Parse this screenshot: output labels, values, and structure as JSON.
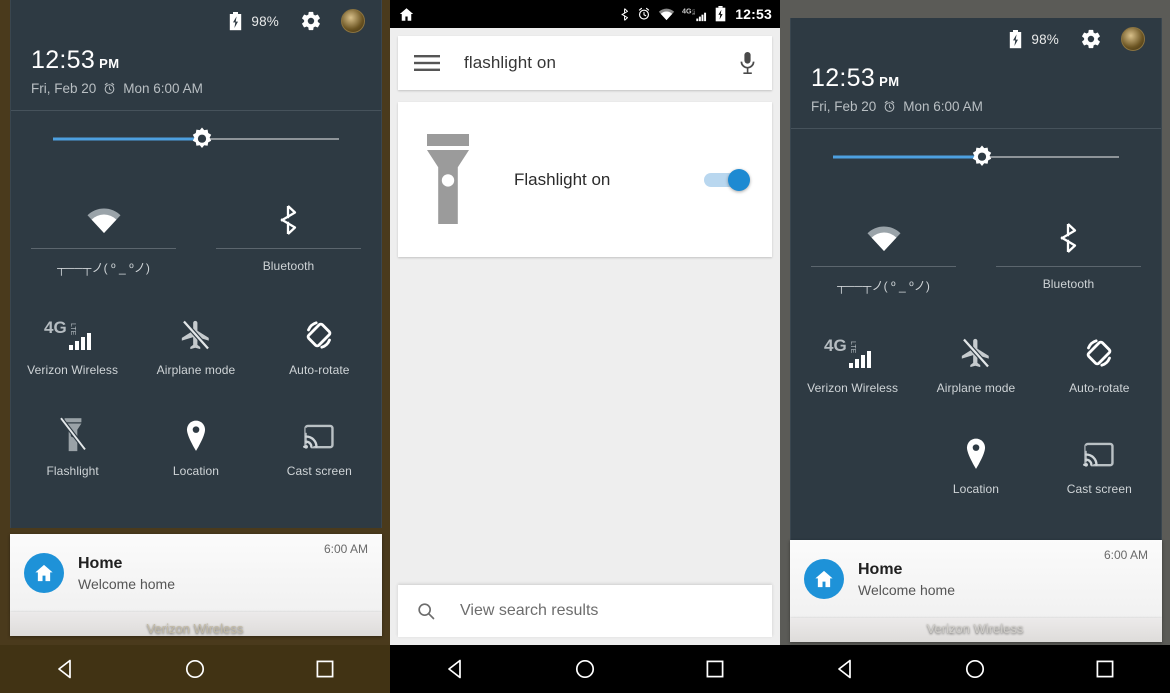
{
  "panels": {
    "left": {
      "name": "quick-settings-flashlight-available",
      "statusbar": {
        "battery_pct": "98%"
      },
      "clock": {
        "time": "12:53",
        "ampm": "PM",
        "date": "Fri, Feb 20",
        "alarm": "Mon 6:00 AM"
      },
      "brightness": {
        "value_pct": 52
      },
      "duo_tiles": [
        {
          "icon": "wifi-icon",
          "label": "┬──┬ノ( º _ ºノ)"
        },
        {
          "icon": "bluetooth-icon",
          "label": "Bluetooth"
        }
      ],
      "tiles_row1": [
        {
          "icon": "signal-4glte-icon",
          "label": "Verizon Wireless"
        },
        {
          "icon": "airplane-off-icon",
          "label": "Airplane mode"
        },
        {
          "icon": "auto-rotate-icon",
          "label": "Auto-rotate"
        }
      ],
      "tiles_row2": [
        {
          "icon": "flashlight-off-icon",
          "label": "Flashlight"
        },
        {
          "icon": "location-icon",
          "label": "Location"
        },
        {
          "icon": "cast-screen-icon",
          "label": "Cast screen"
        }
      ],
      "notification": {
        "title": "Home",
        "subtitle": "Welcome home",
        "time": "6:00 AM",
        "icon": "home-icon"
      },
      "carrier": "Verizon Wireless",
      "navbar": {
        "back": "back-icon",
        "home": "home-circle-icon",
        "recents": "recents-square-icon"
      }
    },
    "middle": {
      "name": "google-now-flashlight-result",
      "statusbar": {
        "home_icon": "home-icon",
        "icons": [
          "bluetooth-icon",
          "alarm-icon",
          "wifi-icon",
          "signal-4glte-icon",
          "battery-charging-icon"
        ],
        "time": "12:53"
      },
      "search": {
        "menu_icon": "hamburger-icon",
        "query": "flashlight on",
        "mic_icon": "microphone-icon"
      },
      "result_card": {
        "icon": "flashlight-icon",
        "label": "Flashlight on",
        "toggle_on": true
      },
      "view_results": {
        "icon": "search-icon",
        "label": "View search results"
      },
      "navbar": {
        "back": "back-icon",
        "home": "home-circle-icon",
        "recents": "recents-square-icon"
      }
    },
    "right": {
      "name": "quick-settings-flashlight-missing",
      "statusbar": {
        "battery_pct": "98%"
      },
      "clock": {
        "time": "12:53",
        "ampm": "PM",
        "date": "Fri, Feb 20",
        "alarm": "Mon 6:00 AM"
      },
      "brightness": {
        "value_pct": 52
      },
      "duo_tiles": [
        {
          "icon": "wifi-icon",
          "label": "┬──┬ノ( º _ ºノ)"
        },
        {
          "icon": "bluetooth-icon",
          "label": "Bluetooth"
        }
      ],
      "tiles_row1": [
        {
          "icon": "signal-4glte-icon",
          "label": "Verizon Wireless"
        },
        {
          "icon": "airplane-off-icon",
          "label": "Airplane mode"
        },
        {
          "icon": "auto-rotate-icon",
          "label": "Auto-rotate"
        }
      ],
      "tiles_row2": [
        {
          "icon": "location-icon",
          "label": "Location"
        },
        {
          "icon": "cast-screen-icon",
          "label": "Cast screen"
        }
      ],
      "notification": {
        "title": "Home",
        "subtitle": "Welcome home",
        "time": "6:00 AM",
        "icon": "home-icon"
      },
      "carrier": "Verizon Wireless",
      "navbar": {
        "back": "back-icon",
        "home": "home-circle-icon",
        "recents": "recents-square-icon"
      }
    }
  },
  "colors": {
    "shade": "#2e3a43",
    "accent_blue": "#1d8ad2",
    "slider_blue": "#4da0e0",
    "wallpaper_brown": "#4a3a1c",
    "wallpaper_gray": "#5b5b57"
  }
}
